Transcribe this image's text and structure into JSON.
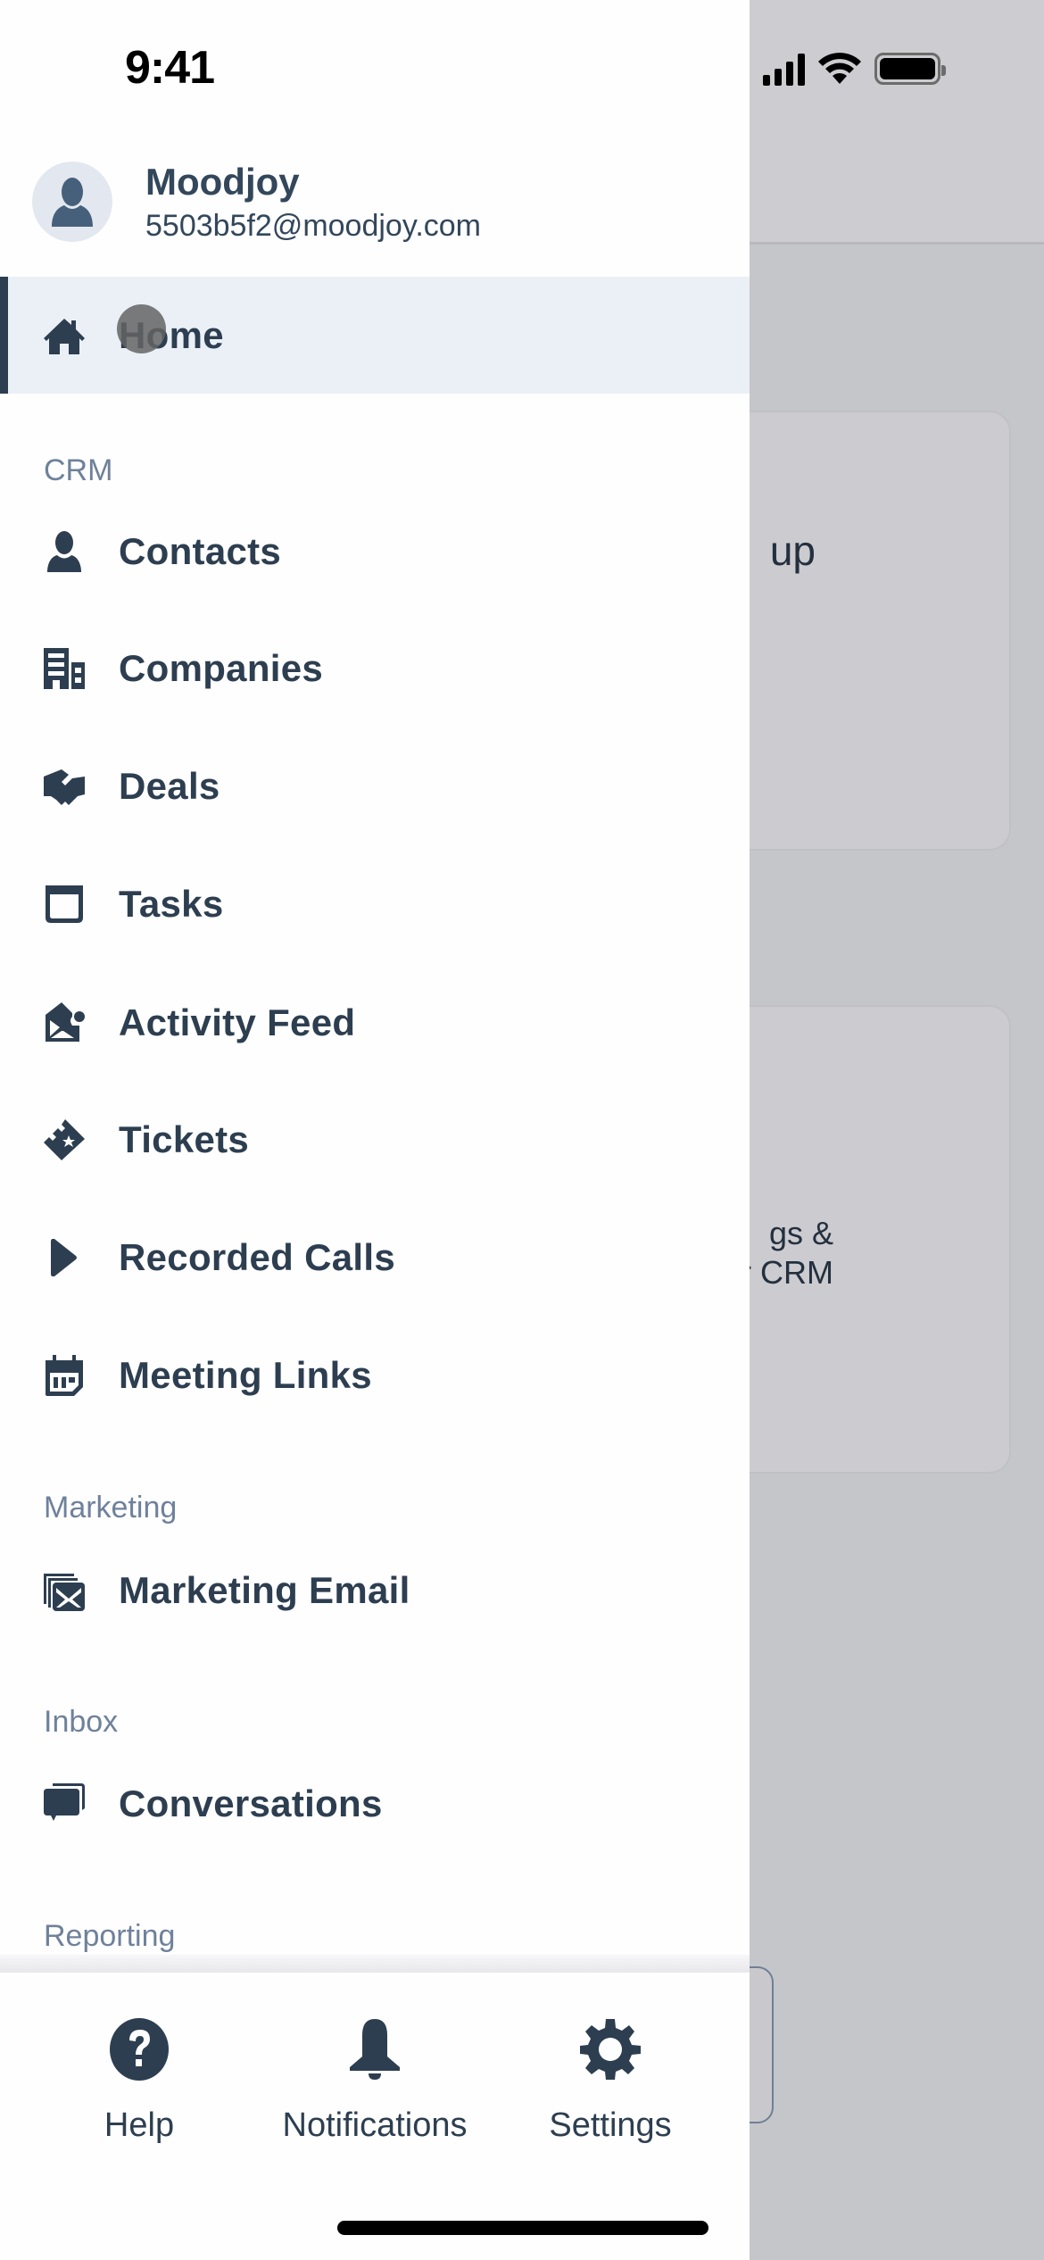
{
  "status_bar": {
    "time": "9:41"
  },
  "profile": {
    "name": "Moodjoy",
    "email": "5503b5f2@moodjoy.com",
    "avatar_icon": "user-silhouette-icon"
  },
  "nav": {
    "home": {
      "label": "Home",
      "icon": "home-icon",
      "active": true
    },
    "sections": [
      {
        "label": "CRM",
        "items": [
          {
            "label": "Contacts",
            "icon": "contact-icon"
          },
          {
            "label": "Companies",
            "icon": "building-icon"
          },
          {
            "label": "Deals",
            "icon": "handshake-icon"
          },
          {
            "label": "Tasks",
            "icon": "tasks-icon"
          },
          {
            "label": "Activity Feed",
            "icon": "activity-feed-icon"
          },
          {
            "label": "Tickets",
            "icon": "ticket-icon"
          },
          {
            "label": "Recorded Calls",
            "icon": "play-icon"
          },
          {
            "label": "Meeting Links",
            "icon": "calendar-icon"
          }
        ]
      },
      {
        "label": "Marketing",
        "items": [
          {
            "label": "Marketing Email",
            "icon": "marketing-email-icon"
          }
        ]
      },
      {
        "label": "Inbox",
        "items": [
          {
            "label": "Conversations",
            "icon": "conversations-icon"
          }
        ]
      },
      {
        "label": "Reporting",
        "items": []
      }
    ]
  },
  "bottom_bar": {
    "help": {
      "label": "Help",
      "icon": "help-icon"
    },
    "notifications": {
      "label": "Notifications",
      "icon": "bell-icon"
    },
    "settings": {
      "label": "Settings",
      "icon": "gear-icon"
    }
  },
  "background": {
    "card1_text": "up",
    "card2_line1": "gs &",
    "card2_line2": "r CRM"
  },
  "colors": {
    "primary_text": "#2d3e50",
    "section_label": "#6f819b",
    "active_bg": "#eaf0f6",
    "scrim": "#c5c6ca"
  }
}
